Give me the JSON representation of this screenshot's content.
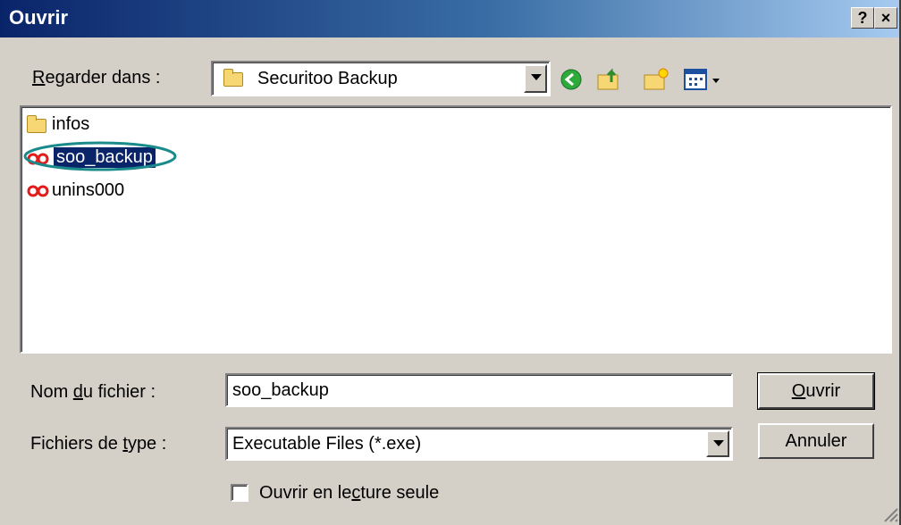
{
  "window": {
    "title": "Ouvrir",
    "help_label": "?",
    "close_label": "×"
  },
  "lookin": {
    "label_pre": "R",
    "label_rest": "egarder dans :",
    "value": "Securitoo Backup"
  },
  "toolbar": {
    "back_icon": "back-arrow-icon",
    "up_icon": "up-folder-icon",
    "newfolder_icon": "new-folder-icon",
    "view_icon": "view-menu-icon"
  },
  "files": [
    {
      "name": "infos",
      "icon": "folder-icon",
      "selected": false
    },
    {
      "name": "soo_backup",
      "icon": "program-icon",
      "selected": true
    },
    {
      "name": "unins000",
      "icon": "program-icon",
      "selected": false
    }
  ],
  "filename": {
    "label_pre": "Nom ",
    "label_u": "d",
    "label_post": "u fichier :",
    "value": "soo_backup"
  },
  "filetype": {
    "label_pre": "Fichiers de ",
    "label_u": "t",
    "label_post": "ype :",
    "value": "Executable Files (*.exe)"
  },
  "readonly": {
    "label_pre": "Ouvrir en le",
    "label_u": "c",
    "label_post": "ture seule",
    "checked": false
  },
  "buttons": {
    "open_u": "O",
    "open_rest": "uvrir",
    "cancel": "Annuler"
  },
  "colors": {
    "titlebar_start": "#0a246a",
    "selection": "#0a246a",
    "annotation_ellipse": "#1a8a8a"
  }
}
